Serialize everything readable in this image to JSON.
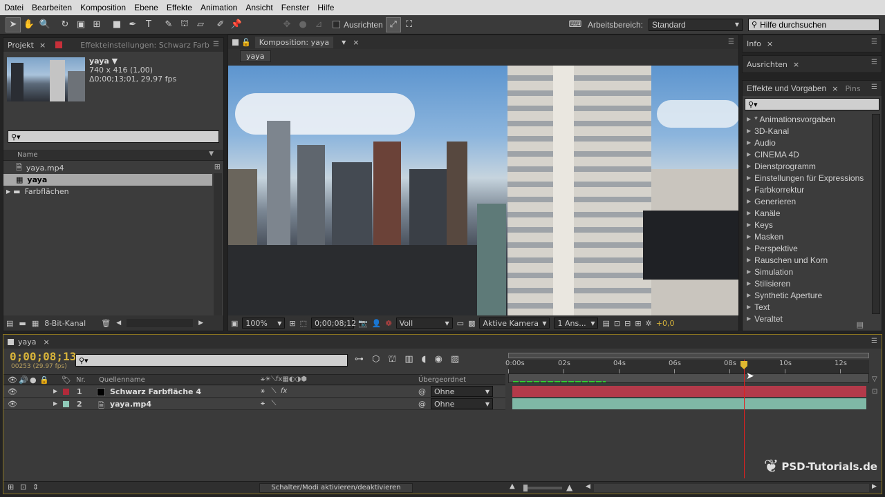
{
  "menu": [
    "Datei",
    "Bearbeiten",
    "Komposition",
    "Ebene",
    "Effekte",
    "Animation",
    "Ansicht",
    "Fenster",
    "Hilfe"
  ],
  "toolbar": {
    "align_label": "Ausrichten",
    "workspace_label": "Arbeitsbereich:",
    "workspace_value": "Standard",
    "help_placeholder": "Hilfe durchsuchen"
  },
  "project": {
    "tab_label": "Projekt",
    "effects_tab": "Effekteinstellungen: Schwarz Farb",
    "item_name": "yaya ▼",
    "item_size": "740 x 416 (1,00)",
    "item_duration": "Δ0;00;13;01, 29,97 fps",
    "col_name": "Name",
    "items": [
      {
        "name": "yaya.mp4"
      },
      {
        "name": "yaya"
      },
      {
        "name": "Farbflächen"
      }
    ],
    "bitdepth": "8-Bit-Kanal"
  },
  "composition": {
    "tab_label": "Komposition: yaya",
    "subtab": "yaya",
    "zoom": "100%",
    "timecode": "0;00;08;12",
    "resolution": "Voll",
    "camera": "Aktive Kamera",
    "views": "1 Ans...",
    "exposure": "+0,0"
  },
  "info_tab": "Info",
  "align_tab": "Ausrichten",
  "effects": {
    "tab_label": "Effekte und Vorgaben",
    "tab2": "Pins",
    "items": [
      "* Animationsvorgaben",
      "3D-Kanal",
      "Audio",
      "CINEMA 4D",
      "Dienstprogramm",
      "Einstellungen für Expressions",
      "Farbkorrektur",
      "Generieren",
      "Kanäle",
      "Keys",
      "Masken",
      "Perspektive",
      "Rauschen und Korn",
      "Simulation",
      "Stilisieren",
      "Synthetic Aperture",
      "Text",
      "Veraltet"
    ]
  },
  "timeline": {
    "tab_label": "yaya",
    "timecode": "0;00;08;13",
    "frames": "00253 (29.97 fps)",
    "col_nr": "Nr.",
    "col_source": "Quellenname",
    "col_parent": "Übergeordnet",
    "ruler": [
      "0:00s",
      "02s",
      "04s",
      "06s",
      "08s",
      "10s",
      "12s"
    ],
    "playhead": 0.654,
    "layers": [
      {
        "nr": "1",
        "name": "Schwarz Farbfläche 4",
        "parent": "Ohne",
        "color": "#b22a3a",
        "bar": "#b33a4a"
      },
      {
        "nr": "2",
        "name": "yaya.mp4",
        "parent": "Ohne",
        "color": "#8fc9b8",
        "bar": "#7fb8a6"
      }
    ],
    "toggle_label": "Schalter/Modi aktivieren/deaktivieren"
  },
  "watermark": "PSD-Tutorials.de"
}
